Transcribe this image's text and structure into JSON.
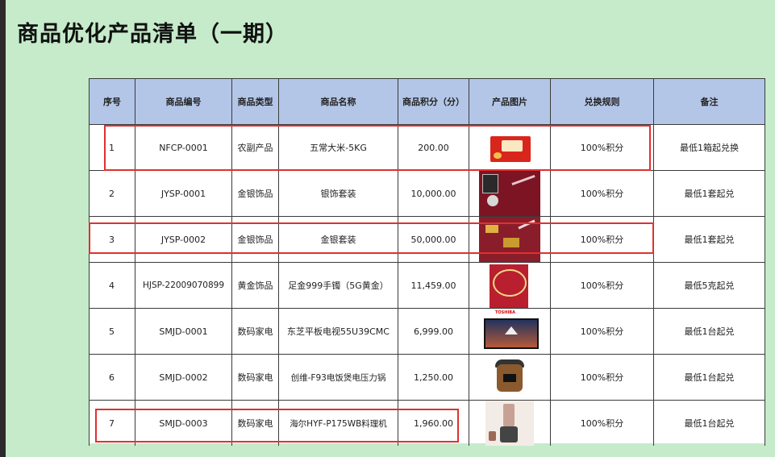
{
  "title": "商品优化产品清单（一期）",
  "colors": {
    "background": "#c6ebcb",
    "header_fill": "#b4c6e7",
    "highlight": "#e03030"
  },
  "table": {
    "headers": [
      "序号",
      "商品编号",
      "商品类型",
      "商品名称",
      "商品积分（分）",
      "产品图片",
      "兑换规则",
      "备注"
    ],
    "rows": [
      {
        "no": "1",
        "code": "NFCP-0001",
        "type": "农副产品",
        "name": "五常大米-5KG",
        "points": "200.00",
        "image": "rice-gift-box",
        "rule": "100%积分",
        "note": "最低1箱起兑换"
      },
      {
        "no": "2",
        "code": "JYSP-0001",
        "type": "金银饰品",
        "name": "银饰套装",
        "points": "10,000.00",
        "image": "silver-jewelry-set",
        "rule": "100%积分",
        "note": "最低1套起兑"
      },
      {
        "no": "3",
        "code": "JYSP-0002",
        "type": "金银饰品",
        "name": "金银套装",
        "points": "50,000.00",
        "image": "gold-silver-set",
        "rule": "100%积分",
        "note": "最低1套起兑"
      },
      {
        "no": "4",
        "code": "HJSP-22009070899",
        "type": "黄金饰品",
        "name": "足金999手镯（5G黄金）",
        "points": "11,459.00",
        "image": "gold-bracelet",
        "rule": "100%积分",
        "note": "最低5克起兑"
      },
      {
        "no": "5",
        "code": "SMJD-0001",
        "type": "数码家电",
        "name": "东芝平板电视55U39CMC",
        "points": "6,999.00",
        "image": "toshiba-tv",
        "rule": "100%积分",
        "note": "最低1台起兑"
      },
      {
        "no": "6",
        "code": "SMJD-0002",
        "type": "数码家电",
        "name": "创维-F93电饭煲电压力锅",
        "points": "1,250.00",
        "image": "pressure-cooker",
        "rule": "100%积分",
        "note": "最低1台起兑"
      },
      {
        "no": "7",
        "code": "SMJD-0003",
        "type": "数码家电",
        "name": "海尔HYF-P175WB料理机",
        "points": "1,960.00",
        "image": "blender",
        "rule": "100%积分",
        "note": "最低1台起兑"
      }
    ]
  },
  "tv_brand": "TOSHIBA"
}
